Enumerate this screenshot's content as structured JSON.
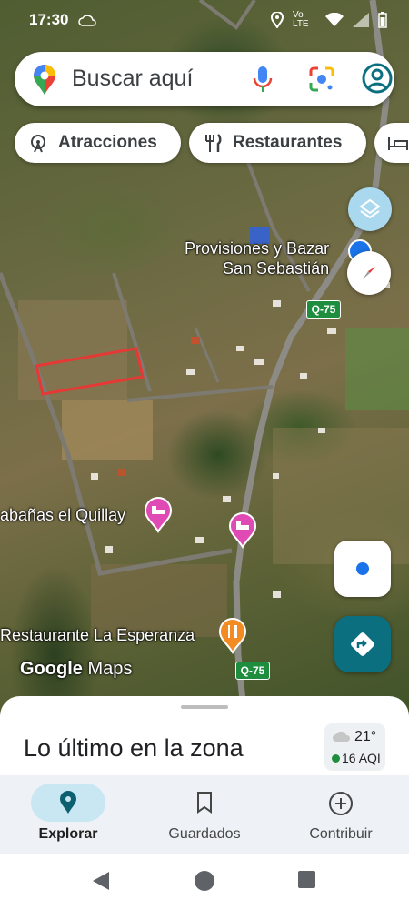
{
  "status_bar": {
    "time": "17:30",
    "network": "Vo LTE"
  },
  "search": {
    "placeholder": "Buscar aquí"
  },
  "chips": [
    {
      "label": "Atracciones",
      "icon": "ferris-wheel-icon"
    },
    {
      "label": "Restaurantes",
      "icon": "fork-knife-icon"
    },
    {
      "label": "",
      "icon": "bed-icon"
    }
  ],
  "map": {
    "labels": {
      "store_line1": "Provisiones y Bazar",
      "store_line2": "San Sebastián",
      "cabins": "abañas el Quillay",
      "restaurant": "Restaurante La Esperanza"
    },
    "road_badges": [
      "Q-75",
      "Q-75"
    ],
    "attribution_google": "Google",
    "attribution_maps": "Maps",
    "colors": {
      "hotel_pin": "#e04ab4",
      "restaurant_pin": "#f28b22",
      "store_pin": "#1a73e8",
      "road_badge": "#1e8e3e",
      "selection_outline": "#e53935"
    }
  },
  "sheet": {
    "title": "Lo último en la zona",
    "weather": {
      "temp": "21°",
      "aqi": "16 AQI"
    }
  },
  "bottom_nav": [
    {
      "label": "Explorar",
      "icon": "explore-pin-icon",
      "active": true
    },
    {
      "label": "Guardados",
      "icon": "bookmark-icon",
      "active": false
    },
    {
      "label": "Contribuir",
      "icon": "add-circle-icon",
      "active": false
    }
  ]
}
